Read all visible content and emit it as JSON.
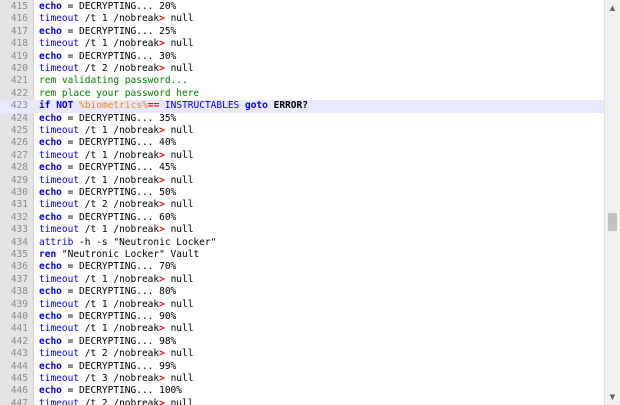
{
  "editor": {
    "scrollbar": {
      "up_arrow": "▲",
      "down_arrow": "▼"
    },
    "current_line": 423,
    "lines": [
      {
        "n": "415",
        "tokens": [
          {
            "t": "echo",
            "s": "kwb"
          },
          {
            "t": " = DECRYPTING... 20%",
            "s": "text"
          }
        ]
      },
      {
        "n": "416",
        "tokens": [
          {
            "t": "timeout",
            "s": "kw"
          },
          {
            "t": " /t 1 /nobreak",
            "s": "text"
          },
          {
            "t": ">",
            "s": "op"
          },
          {
            "t": " null",
            "s": "text"
          }
        ]
      },
      {
        "n": "417",
        "tokens": [
          {
            "t": "echo",
            "s": "kwb"
          },
          {
            "t": " = DECRYPTING... 25%",
            "s": "text"
          }
        ]
      },
      {
        "n": "418",
        "tokens": [
          {
            "t": "timeout",
            "s": "kw"
          },
          {
            "t": " /t 1 /nobreak",
            "s": "text"
          },
          {
            "t": ">",
            "s": "op"
          },
          {
            "t": " null",
            "s": "text"
          }
        ]
      },
      {
        "n": "419",
        "tokens": [
          {
            "t": "echo",
            "s": "kwb"
          },
          {
            "t": " = DECRYPTING... 30%",
            "s": "text"
          }
        ]
      },
      {
        "n": "420",
        "tokens": [
          {
            "t": "timeout",
            "s": "kw"
          },
          {
            "t": " /t 2 /nobreak",
            "s": "text"
          },
          {
            "t": ">",
            "s": "op"
          },
          {
            "t": " null",
            "s": "text"
          }
        ]
      },
      {
        "n": "421",
        "tokens": [
          {
            "t": "rem validating password...",
            "s": "comment"
          }
        ]
      },
      {
        "n": "422",
        "tokens": [
          {
            "t": "rem place your password here",
            "s": "comment"
          }
        ]
      },
      {
        "n": "423",
        "tokens": [
          {
            "t": "if",
            "s": "kwb"
          },
          {
            "t": " ",
            "s": "text"
          },
          {
            "t": "NOT",
            "s": "kwb"
          },
          {
            "t": " ",
            "s": "text"
          },
          {
            "t": "%biometrics%",
            "s": "var"
          },
          {
            "t": "==",
            "s": "op"
          },
          {
            "t": " INSTRUCTABLES ",
            "s": "kw"
          },
          {
            "t": "goto",
            "s": "kwb"
          },
          {
            "t": " ERROR?",
            "s": "label"
          }
        ]
      },
      {
        "n": "424",
        "tokens": [
          {
            "t": "echo",
            "s": "kwb"
          },
          {
            "t": " = DECRYPTING... 35%",
            "s": "text"
          }
        ]
      },
      {
        "n": "425",
        "tokens": [
          {
            "t": "timeout",
            "s": "kw"
          },
          {
            "t": " /t 1 /nobreak",
            "s": "text"
          },
          {
            "t": ">",
            "s": "op"
          },
          {
            "t": " null",
            "s": "text"
          }
        ]
      },
      {
        "n": "426",
        "tokens": [
          {
            "t": "echo",
            "s": "kwb"
          },
          {
            "t": " = DECRYPTING... 40%",
            "s": "text"
          }
        ]
      },
      {
        "n": "427",
        "tokens": [
          {
            "t": "timeout",
            "s": "kw"
          },
          {
            "t": " /t 1 /nobreak",
            "s": "text"
          },
          {
            "t": ">",
            "s": "op"
          },
          {
            "t": " null",
            "s": "text"
          }
        ]
      },
      {
        "n": "428",
        "tokens": [
          {
            "t": "echo",
            "s": "kwb"
          },
          {
            "t": " = DECRYPTING... 45%",
            "s": "text"
          }
        ]
      },
      {
        "n": "429",
        "tokens": [
          {
            "t": "timeout",
            "s": "kw"
          },
          {
            "t": " /t 1 /nobreak",
            "s": "text"
          },
          {
            "t": ">",
            "s": "op"
          },
          {
            "t": " null",
            "s": "text"
          }
        ]
      },
      {
        "n": "430",
        "tokens": [
          {
            "t": "echo",
            "s": "kwb"
          },
          {
            "t": " = DECRYPTING... 50%",
            "s": "text"
          }
        ]
      },
      {
        "n": "431",
        "tokens": [
          {
            "t": "timeout",
            "s": "kw"
          },
          {
            "t": " /t 2 /nobreak",
            "s": "text"
          },
          {
            "t": ">",
            "s": "op"
          },
          {
            "t": " null",
            "s": "text"
          }
        ]
      },
      {
        "n": "432",
        "tokens": [
          {
            "t": "echo",
            "s": "kwb"
          },
          {
            "t": " = DECRYPTING... 60%",
            "s": "text"
          }
        ]
      },
      {
        "n": "433",
        "tokens": [
          {
            "t": "timeout",
            "s": "kw"
          },
          {
            "t": " /t 1 /nobreak",
            "s": "text"
          },
          {
            "t": ">",
            "s": "op"
          },
          {
            "t": " null",
            "s": "text"
          }
        ]
      },
      {
        "n": "434",
        "tokens": [
          {
            "t": "attrib",
            "s": "kw"
          },
          {
            "t": " -h -s \"Neutronic Locker\"",
            "s": "text"
          }
        ]
      },
      {
        "n": "435",
        "tokens": [
          {
            "t": "ren",
            "s": "kwb"
          },
          {
            "t": " \"Neutronic Locker\" Vault",
            "s": "text"
          }
        ]
      },
      {
        "n": "436",
        "tokens": [
          {
            "t": "echo",
            "s": "kwb"
          },
          {
            "t": " = DECRYPTING... 70%",
            "s": "text"
          }
        ]
      },
      {
        "n": "437",
        "tokens": [
          {
            "t": "timeout",
            "s": "kw"
          },
          {
            "t": " /t 1 /nobreak",
            "s": "text"
          },
          {
            "t": ">",
            "s": "op"
          },
          {
            "t": " null",
            "s": "text"
          }
        ]
      },
      {
        "n": "438",
        "tokens": [
          {
            "t": "echo",
            "s": "kwb"
          },
          {
            "t": " = DECRYPTING... 80%",
            "s": "text"
          }
        ]
      },
      {
        "n": "439",
        "tokens": [
          {
            "t": "timeout",
            "s": "kw"
          },
          {
            "t": " /t 1 /nobreak",
            "s": "text"
          },
          {
            "t": ">",
            "s": "op"
          },
          {
            "t": " null",
            "s": "text"
          }
        ]
      },
      {
        "n": "440",
        "tokens": [
          {
            "t": "echo",
            "s": "kwb"
          },
          {
            "t": " = DECRYPTING... 90%",
            "s": "text"
          }
        ]
      },
      {
        "n": "441",
        "tokens": [
          {
            "t": "timeout",
            "s": "kw"
          },
          {
            "t": " /t 1 /nobreak",
            "s": "text"
          },
          {
            "t": ">",
            "s": "op"
          },
          {
            "t": " null",
            "s": "text"
          }
        ]
      },
      {
        "n": "442",
        "tokens": [
          {
            "t": "echo",
            "s": "kwb"
          },
          {
            "t": " = DECRYPTING... 98%",
            "s": "text"
          }
        ]
      },
      {
        "n": "443",
        "tokens": [
          {
            "t": "timeout",
            "s": "kw"
          },
          {
            "t": " /t 2 /nobreak",
            "s": "text"
          },
          {
            "t": ">",
            "s": "op"
          },
          {
            "t": " null",
            "s": "text"
          }
        ]
      },
      {
        "n": "444",
        "tokens": [
          {
            "t": "echo",
            "s": "kwb"
          },
          {
            "t": " = DECRYPTING... 99%",
            "s": "text"
          }
        ]
      },
      {
        "n": "445",
        "tokens": [
          {
            "t": "timeout",
            "s": "kw"
          },
          {
            "t": " /t 3 /nobreak",
            "s": "text"
          },
          {
            "t": ">",
            "s": "op"
          },
          {
            "t": " null",
            "s": "text"
          }
        ]
      },
      {
        "n": "446",
        "tokens": [
          {
            "t": "echo",
            "s": "kwb"
          },
          {
            "t": " = DECRYPTING... 100%",
            "s": "text"
          }
        ]
      },
      {
        "n": "447",
        "tokens": [
          {
            "t": "timeout",
            "s": "kw"
          },
          {
            "t": " /t 2 /nobreak",
            "s": "text"
          },
          {
            "t": ">",
            "s": "op"
          },
          {
            "t": " null",
            "s": "text"
          }
        ]
      }
    ]
  }
}
